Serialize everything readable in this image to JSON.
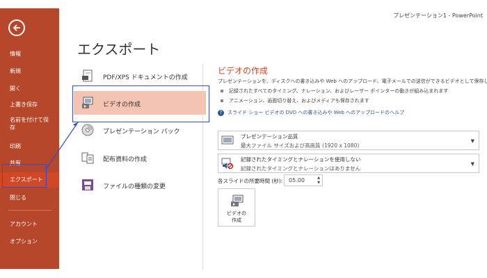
{
  "window": {
    "title": "プレゼンテーション1 - PowerPoint"
  },
  "nav": {
    "back_icon": "back-arrow-icon",
    "items": [
      {
        "label": "情報",
        "id": "info"
      },
      {
        "label": "新規",
        "id": "new"
      },
      {
        "label": "開く",
        "id": "open"
      },
      {
        "label": "上書き保存",
        "id": "save"
      },
      {
        "label": "名前を付けて保存",
        "id": "save-as"
      },
      {
        "label": "印刷",
        "id": "print"
      },
      {
        "label": "共有",
        "id": "share"
      },
      {
        "label": "エクスポート",
        "id": "export",
        "selected": true
      },
      {
        "label": "閉じる",
        "id": "close"
      },
      {
        "label": "アカウント",
        "id": "account"
      },
      {
        "label": "オプション",
        "id": "options"
      }
    ]
  },
  "page": {
    "title": "エクスポート"
  },
  "export_options": [
    {
      "label": "PDF/XPS ドキュメントの作成",
      "icon": "pdf-document-icon"
    },
    {
      "label": "ビデオの作成",
      "icon": "video-icon",
      "selected": true
    },
    {
      "label": "プレゼンテーション パック",
      "icon": "cd-package-icon"
    },
    {
      "label": "配布資料の作成",
      "icon": "handout-icon"
    },
    {
      "label": "ファイルの種類の変更",
      "icon": "file-type-icon"
    }
  ],
  "detail": {
    "title": "ビデオの作成",
    "description": "プレゼンテーションを、ディスクへの書き込みや Web へのアップロード、電子メールでの送信ができるビデオとして保存します。",
    "bullets": [
      "記録されたすべてのタイミング、ナレーション、およびレーザー ポインターの動きが組み込まれます",
      "アニメーション、画面切り替え、およびメディアも保存されます"
    ],
    "help_link": "スライド ショー ビデオの DVD への書き込みや Web へのアップロードのヘルプ",
    "quality_dropdown": {
      "line1": "プレゼンテーション品質",
      "line2": "最大ファイル サイズおよび高画質 (1920 x 1080)"
    },
    "timing_dropdown": {
      "line1": "記録されたタイミングとナレーションを使用しない",
      "line2": "記録されたタイミングとナレーションはありません"
    },
    "seconds_label": "各スライドの所要時間 (秒):",
    "seconds_value": "05.00",
    "create_button": {
      "line1": "ビデオの",
      "line2": "作成"
    }
  },
  "colors": {
    "nav_bg": "#b7472a",
    "nav_selected": "#d24726",
    "accent": "#d24726",
    "list_selected": "#f4c3b1",
    "annotation": "#2e4ed6"
  }
}
